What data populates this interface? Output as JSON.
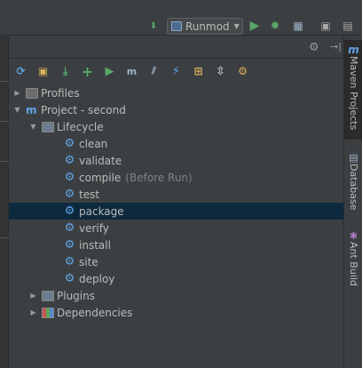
{
  "toolbar": {
    "run_config": "Runmod",
    "icons": [
      "build-icon",
      "run-config-icon",
      "run-icon",
      "debug-icon",
      "coverage-icon",
      "stop-icon"
    ]
  },
  "maven_toolbar": {
    "buttons": [
      "reimport-icon",
      "generate-sources-icon",
      "download-icon",
      "add-icon",
      "run-build-icon",
      "execute-goal-icon",
      "toggle-offline-icon",
      "skip-tests-icon",
      "show-dependencies-icon",
      "collapse-all-icon",
      "settings-icon"
    ]
  },
  "tree": {
    "profiles": "Profiles",
    "project": "Project - second",
    "lifecycle": "Lifecycle",
    "goals": [
      {
        "label": "clean",
        "suffix": ""
      },
      {
        "label": "validate",
        "suffix": ""
      },
      {
        "label": "compile",
        "suffix": "(Before Run)"
      },
      {
        "label": "test",
        "suffix": ""
      },
      {
        "label": "package",
        "suffix": ""
      },
      {
        "label": "verify",
        "suffix": ""
      },
      {
        "label": "install",
        "suffix": ""
      },
      {
        "label": "site",
        "suffix": ""
      },
      {
        "label": "deploy",
        "suffix": ""
      }
    ],
    "selected": "package",
    "plugins": "Plugins",
    "dependencies": "Dependencies"
  },
  "right_tabs": {
    "maven": "Maven Projects",
    "database": "Database",
    "ant": "Ant Build"
  },
  "colors": {
    "background": "#3c3f41",
    "selection": "#0d293e",
    "accent_blue": "#5fa3e6",
    "green": "#59a869"
  }
}
